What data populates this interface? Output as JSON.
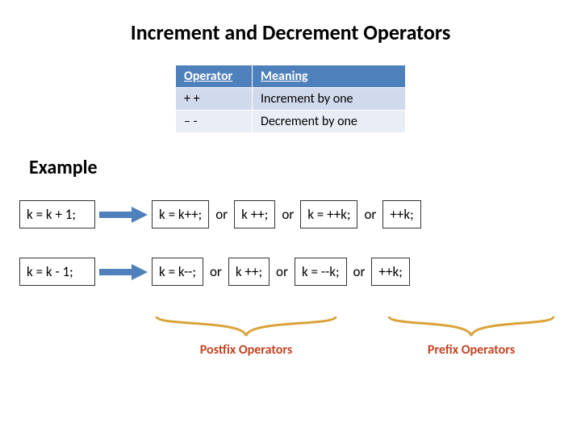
{
  "title": "Increment and Decrement Operators",
  "table": {
    "headers": {
      "operator": "Operator",
      "meaning": "Meaning"
    },
    "rows": [
      {
        "op": "+ +",
        "mean": "Increment by one"
      },
      {
        "op": "– -",
        "mean": "Decrement by one"
      }
    ]
  },
  "example_heading": "Example",
  "or": "or",
  "rows": [
    {
      "lhs": "k = k + 1;",
      "c1": "k = k++;",
      "c2": "k ++;",
      "c3": "k = ++k;",
      "c4": "++k;"
    },
    {
      "lhs": "k = k  - 1;",
      "c1": "k = k--;",
      "c2": "k ++;",
      "c3": "k = --k;",
      "c4": "++k;"
    }
  ],
  "labels": {
    "postfix": "Postfix Operators",
    "prefix": "Prefix Operators"
  },
  "colors": {
    "arrow": "#4e80bb",
    "brace": "#d9a33a",
    "label": "#c44423"
  }
}
